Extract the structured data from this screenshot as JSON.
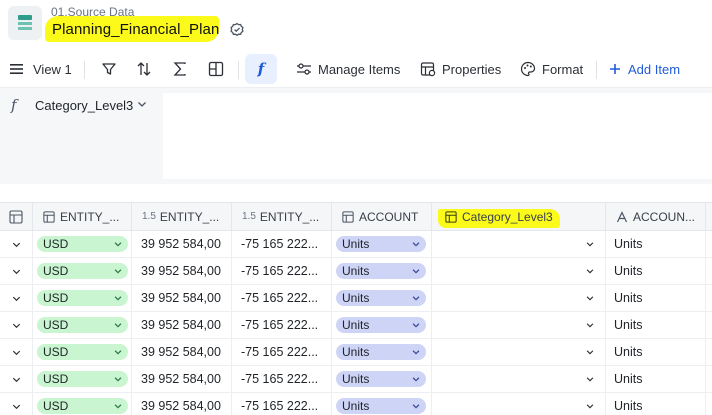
{
  "header": {
    "breadcrumb": "01.Source Data",
    "title": "Planning_Financial_Plan",
    "app_icon": "table-app-icon",
    "badge_icon": "verified-badge-icon",
    "highlight_color": "#fbfa1b"
  },
  "toolbar": {
    "view_label": "View 1",
    "manage_items": "Manage Items",
    "properties": "Properties",
    "format": "Format",
    "add_item": "Add Item",
    "accent_color": "#1f5bd8"
  },
  "formula": {
    "symbol": "f",
    "field": "Category_Level3"
  },
  "grid": {
    "columns": [
      {
        "label": "ENTITY_...",
        "icon": "table-icon"
      },
      {
        "label": "ENTITY_...",
        "prefix": "1.5"
      },
      {
        "label": "ENTITY_...",
        "prefix": "1.5"
      },
      {
        "label": "ACCOUNT",
        "icon": "table-icon"
      },
      {
        "label": "Category_Level3",
        "icon": "table-icon"
      },
      {
        "label": "ACCOUN...",
        "icon": "text-icon"
      }
    ],
    "rows": [
      {
        "entity": "USD",
        "value1": "39 952 584,00",
        "value2": "-75 165 222...",
        "account": "Units",
        "category": "",
        "account_text": "Units"
      },
      {
        "entity": "USD",
        "value1": "39 952 584,00",
        "value2": "-75 165 222...",
        "account": "Units",
        "category": "",
        "account_text": "Units"
      },
      {
        "entity": "USD",
        "value1": "39 952 584,00",
        "value2": "-75 165 222...",
        "account": "Units",
        "category": "",
        "account_text": "Units"
      },
      {
        "entity": "USD",
        "value1": "39 952 584,00",
        "value2": "-75 165 222...",
        "account": "Units",
        "category": "",
        "account_text": "Units"
      },
      {
        "entity": "USD",
        "value1": "39 952 584,00",
        "value2": "-75 165 222...",
        "account": "Units",
        "category": "",
        "account_text": "Units"
      },
      {
        "entity": "USD",
        "value1": "39 952 584,00",
        "value2": "-75 165 222...",
        "account": "Units",
        "category": "",
        "account_text": "Units"
      },
      {
        "entity": "USD",
        "value1": "39 952 584,00",
        "value2": "-75 165 222...",
        "account": "Units",
        "category": "",
        "account_text": "Units"
      }
    ],
    "colors": {
      "usd_pill": "#c9f5d1",
      "units_pill": "#cdd4f6"
    }
  }
}
